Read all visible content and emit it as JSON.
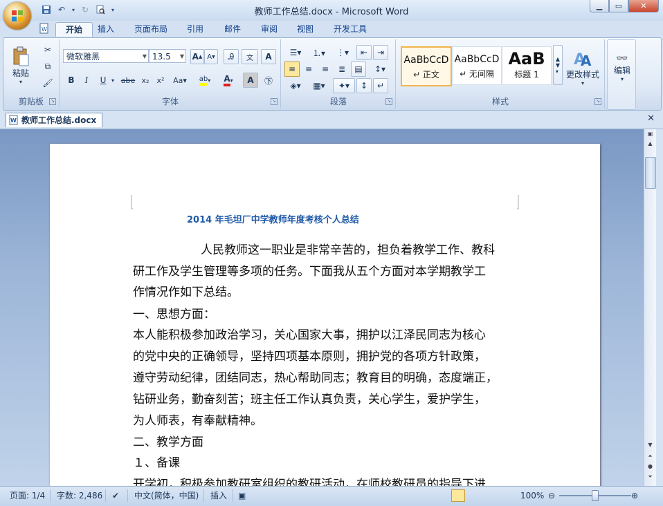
{
  "window": {
    "title": "教师工作总结.docx - Microsoft Word"
  },
  "tabs": [
    {
      "label": "开始"
    },
    {
      "label": "插入"
    },
    {
      "label": "页面布局"
    },
    {
      "label": "引用"
    },
    {
      "label": "邮件"
    },
    {
      "label": "审阅"
    },
    {
      "label": "视图"
    },
    {
      "label": "开发工具"
    }
  ],
  "ribbon": {
    "clipboard": {
      "label": "剪贴板",
      "paste": "粘贴"
    },
    "font": {
      "label": "字体",
      "name": "微软雅黑",
      "size": "13.5"
    },
    "paragraph": {
      "label": "段落"
    },
    "styles": {
      "label": "样式",
      "items": [
        {
          "sample": "AaBbCcD",
          "name": "↵ 正文"
        },
        {
          "sample": "AaBbCcD",
          "name": "↵ 无间隔"
        },
        {
          "sample": "AaB",
          "name": "标题 1"
        }
      ],
      "change": "更改样式"
    },
    "editing": {
      "label": "编辑"
    }
  },
  "document": {
    "tab_label": "教师工作总结.docx",
    "title": "2014 年毛坦厂中学教师年度考核个人总结",
    "lines": [
      "人民教师这一职业是非常辛苦的，担负着教学工作、教科",
      "研工作及学生管理等多项的任务。下面我从五个方面对本学期教学工",
      "作情况作如下总结。",
      "一、思想方面：",
      "本人能积极参加政治学习，关心国家大事，拥护以江泽民同志为核心",
      "的党中央的正确领导，坚持四项基本原则，拥护党的各项方针政策，",
      "遵守劳动纪律，团结同志，热心帮助同志；教育目的明确，态度端正，",
      "钻研业务，勤奋刻苦；班主任工作认真负责，关心学生，爱护学生，",
      "为人师表，有奉献精神。",
      "二、教学方面",
      "１、备课",
      "开学初，积极参加教研室组织的教研活动，在师校教研员的指导下进"
    ]
  },
  "status": {
    "page": "页面: 1/4",
    "words": "字数: 2,486",
    "language": "中文(简体，中国)",
    "mode": "插入",
    "zoom": "100%"
  }
}
